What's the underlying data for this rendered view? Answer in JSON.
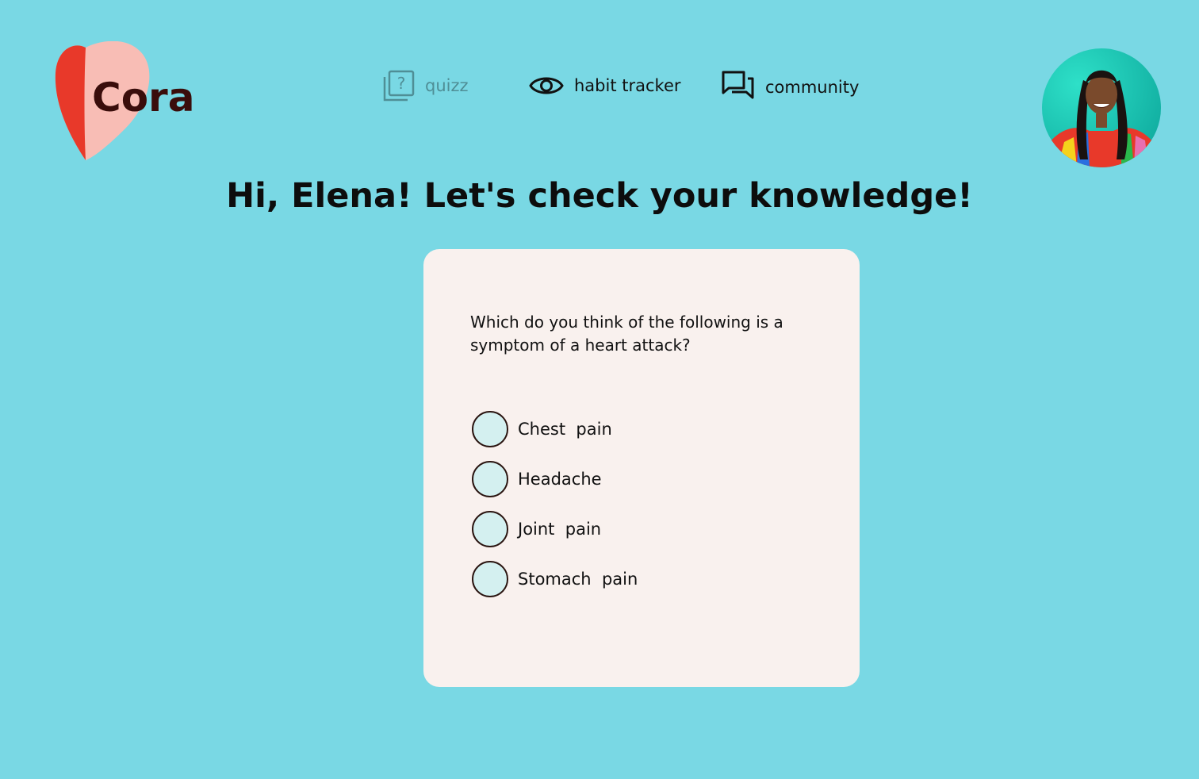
{
  "brand": {
    "name": "Cora",
    "colors": {
      "heart_left": "#e8392a",
      "heart_right": "#f8bdb5",
      "text": "#3a0d0b"
    }
  },
  "nav": {
    "quizz": {
      "label": "quizz",
      "icon": "quiz-icon"
    },
    "habit": {
      "label": "habit tracker",
      "icon": "eye-icon"
    },
    "community": {
      "label": "community",
      "icon": "chat-bubbles-icon"
    }
  },
  "profile": {
    "icon": "avatar"
  },
  "headline": "Hi, Elena! Let's check your knowledge!",
  "quiz": {
    "question": "Which do you think of the following is a symptom of a heart attack?",
    "options": [
      "Chest  pain",
      "Headache",
      "Joint  pain",
      "Stomach  pain"
    ]
  },
  "colors": {
    "background": "#79d8e4",
    "card": "#f9f1ee",
    "radio_fill": "#d4f0f0",
    "nav_muted": "#4f8e96"
  }
}
